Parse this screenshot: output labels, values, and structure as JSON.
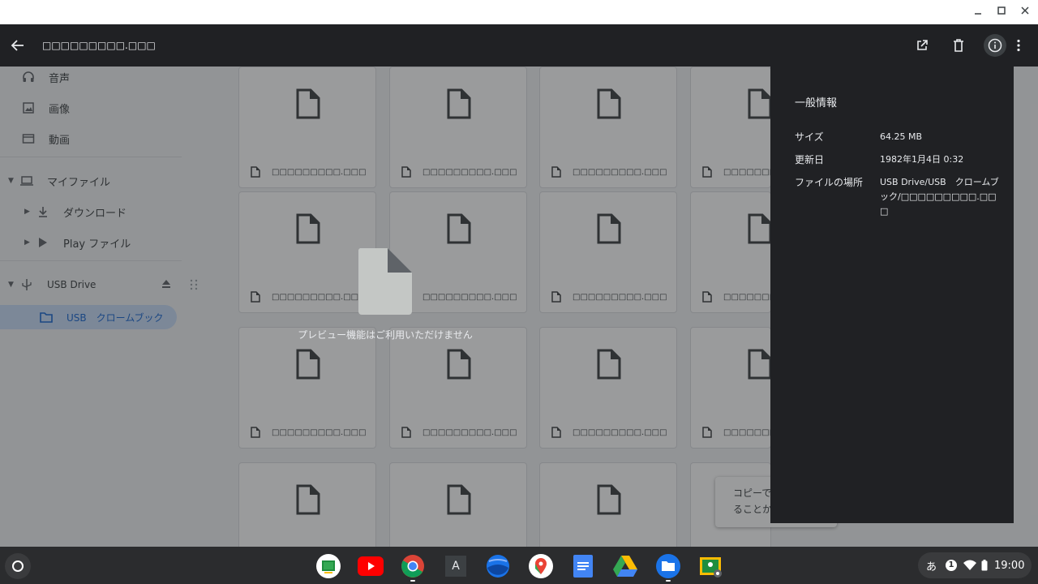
{
  "window": {
    "minimize_icon": "minimize-icon",
    "maximize_icon": "maximize-icon",
    "close_icon": "close-icon"
  },
  "sidebar": {
    "items": [
      {
        "label": "音声",
        "icon": "headphones-icon"
      },
      {
        "label": "画像",
        "icon": "image-icon"
      },
      {
        "label": "動画",
        "icon": "video-icon"
      }
    ],
    "my_files": "マイファイル",
    "downloads": "ダウンロード",
    "play_files": "Play ファイル",
    "usb_drive": "USB Drive",
    "usb_folder": "USB　クロームブック"
  },
  "grid": {
    "file_name": "□□□□□□□□□.□□□",
    "file_name_short": "□□□□□□□□□.□□"
  },
  "toast": {
    "line1": "コピーで",
    "line2": "ることか"
  },
  "viewer": {
    "title": "□□□□□□□□□.□□□",
    "no_preview": "プレビュー機能はご利用いただけません"
  },
  "info": {
    "heading": "一般情報",
    "size_label": "サイズ",
    "size_value": "64.25 MB",
    "modified_label": "更新日",
    "modified_value": "1982年1月4日 0:32",
    "location_label": "ファイルの場所",
    "location_value": "USB Drive/USB　クロームブック/□□□□□□□□□.□□□"
  },
  "shelf": {
    "apps": [
      "classroom-icon",
      "youtube-icon",
      "chrome-icon",
      "text-icon",
      "earth-icon",
      "maps-icon",
      "docs-icon",
      "drive-icon",
      "files-icon",
      "classroom-dev-icon"
    ],
    "text_app_letter": "A",
    "ime": "あ",
    "notification_count": "1",
    "time": "19:00"
  },
  "colors": {
    "accent": "#1967d2",
    "viewer_bar": "#202124",
    "overlay": "#202124"
  }
}
